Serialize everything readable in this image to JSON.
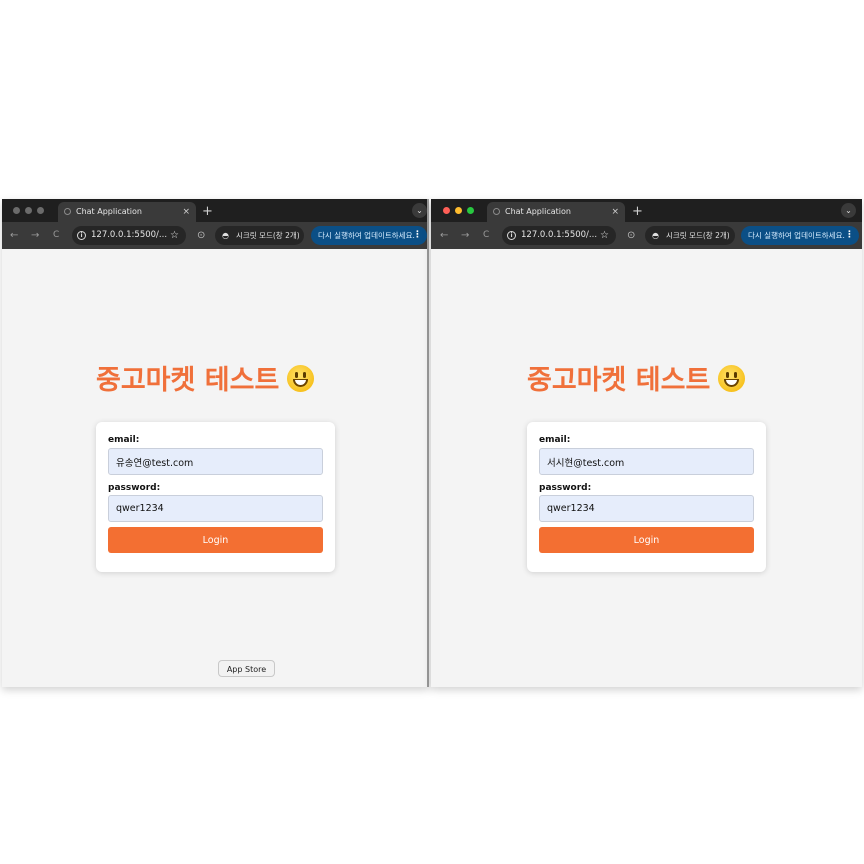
{
  "windows": [
    {
      "tab_title": "Chat Application",
      "tab_close": "×",
      "new_tab": "+",
      "tab_menu": "⌄",
      "nav_back": "←",
      "nav_forward": "→",
      "nav_reload": "C",
      "url": "127.0.0.1:5500/...",
      "incognito_label": "시크릿 모드(창 2개)",
      "update_label": "다시 실행하여 업데이트하세요.",
      "page_title": "중고마켓 테스트",
      "email_label": "email:",
      "email_value": "유송연@test.com",
      "password_label": "password:",
      "password_value": "qwer1234",
      "login_label": "Login",
      "traffic_colors": [
        "#6b6b6b",
        "#6b6b6b",
        "#6b6b6b"
      ]
    },
    {
      "tab_title": "Chat Application",
      "tab_close": "×",
      "new_tab": "+",
      "tab_menu": "⌄",
      "nav_back": "←",
      "nav_forward": "→",
      "nav_reload": "C",
      "url": "127.0.0.1:5500/...",
      "incognito_label": "시크릿 모드(창 2개)",
      "update_label": "다시 실행하여 업데이트하세요.",
      "page_title": "중고마켓 테스트",
      "email_label": "email:",
      "email_value": "서시현@test.com",
      "password_label": "password:",
      "password_value": "qwer1234",
      "login_label": "Login",
      "traffic_colors": [
        "#ff5f57",
        "#febc2e",
        "#28c840"
      ]
    }
  ],
  "dock_tooltip": "App Store",
  "accent_color": "#f36f32"
}
